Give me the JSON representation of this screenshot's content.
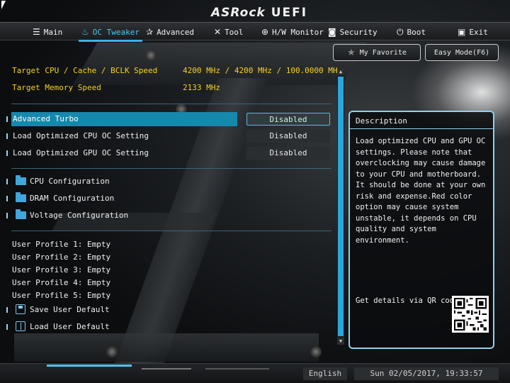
{
  "header": {
    "brand": "ASRock",
    "product": "UEFI"
  },
  "nav": {
    "tabs": [
      {
        "label": "Main",
        "icon": "list-icon",
        "glyph": "☰",
        "active": false
      },
      {
        "label": "OC Tweaker",
        "icon": "flame-icon",
        "glyph": "♨",
        "active": true
      },
      {
        "label": "Advanced",
        "icon": "star-icon",
        "glyph": "✰",
        "active": false
      },
      {
        "label": "Tool",
        "icon": "tools-icon",
        "glyph": "✕",
        "active": false
      },
      {
        "label": "H/W Monitor",
        "icon": "monitor-icon",
        "glyph": "⊕",
        "active": false
      },
      {
        "label": "Security",
        "icon": "shield-icon",
        "glyph": "◙",
        "active": false
      },
      {
        "label": "Boot",
        "icon": "power-icon",
        "glyph": "⏻",
        "active": false
      },
      {
        "label": "Exit",
        "icon": "exit-icon",
        "glyph": "▣",
        "active": false
      }
    ]
  },
  "toolbar": {
    "favorite_label": "My Favorite",
    "favorite_icon": "star-icon",
    "easy_mode_label": "Easy Mode(F6)"
  },
  "targets": [
    {
      "label": "Target CPU / Cache / BCLK Speed",
      "value": "4200 MHz / 4200 MHz / 100.0000 MHz"
    },
    {
      "label": "Target Memory Speed",
      "value": "2133 MHz"
    }
  ],
  "options": [
    {
      "label": "Advanced Turbo",
      "value": "Disabled",
      "selected": true
    },
    {
      "label": "Load Optimized CPU OC Setting",
      "value": "Disabled",
      "selected": false
    },
    {
      "label": "Load Optimized GPU OC Setting",
      "value": "Disabled",
      "selected": false
    }
  ],
  "submenus": [
    {
      "label": "CPU Configuration",
      "icon": "folder-icon"
    },
    {
      "label": "DRAM Configuration",
      "icon": "folder-icon"
    },
    {
      "label": "Voltage Configuration",
      "icon": "folder-icon"
    }
  ],
  "profiles": [
    "User Profile 1: Empty",
    "User Profile 2: Empty",
    "User Profile 3: Empty",
    "User Profile 4: Empty",
    "User Profile 5: Empty"
  ],
  "actions": [
    {
      "label": "Save User Default",
      "icon": "save-icon"
    },
    {
      "label": "Load User Default",
      "icon": "book-icon"
    }
  ],
  "description": {
    "title": "Description",
    "body": "Load optimized CPU and GPU OC settings. Please note that overclocking may cause damage to your CPU and motherboard. It should be done at your own risk and expense.Red color option may cause system unstable, it depends on CPU quality and system environment.",
    "qr_label": "Get details via QR code"
  },
  "statusbar": {
    "language": "English",
    "datetime": "Sun 02/05/2017, 19:33:57"
  },
  "colors": {
    "accent": "#2aa6dd",
    "target_text": "#f5d21a",
    "selected_row": "#1688ac"
  }
}
